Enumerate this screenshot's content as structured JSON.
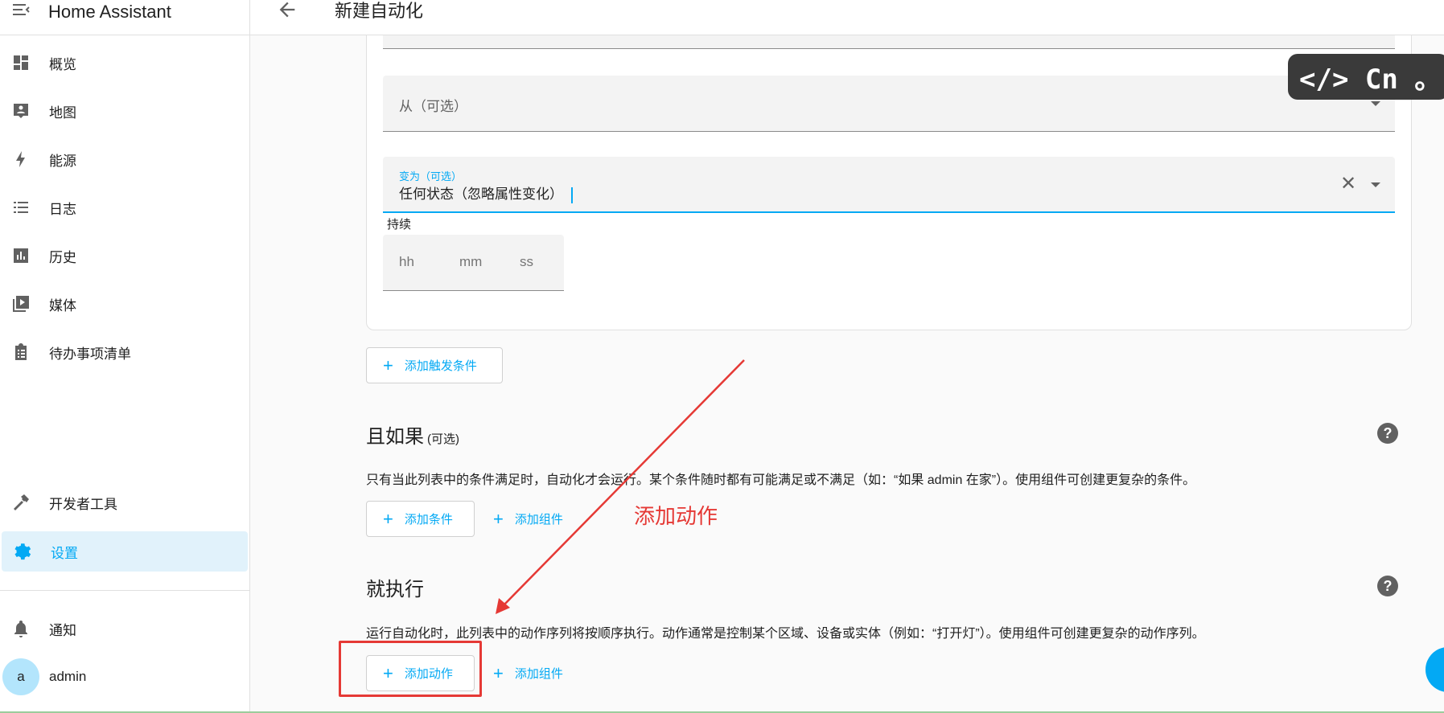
{
  "app": {
    "title": "Home Assistant"
  },
  "header": {
    "title": "新建自动化"
  },
  "sidebar": {
    "items": [
      {
        "label": "概览",
        "icon": "dashboard-icon"
      },
      {
        "label": "地图",
        "icon": "map-account-icon"
      },
      {
        "label": "能源",
        "icon": "lightning-bolt-icon"
      },
      {
        "label": "日志",
        "icon": "list-icon"
      },
      {
        "label": "历史",
        "icon": "chart-box-icon"
      },
      {
        "label": "媒体",
        "icon": "play-box-multiple-icon"
      },
      {
        "label": "待办事项清单",
        "icon": "clipboard-list-icon"
      }
    ],
    "developer_tools": "开发者工具",
    "settings": "设置",
    "notifications": "通知",
    "user": {
      "initial": "a",
      "name": "admin"
    },
    "accent_color": "#03a9f4"
  },
  "trigger": {
    "from_placeholder": "从（可选）",
    "to_label": "变为（可选）",
    "to_value": "任何状态（忽略属性变化）",
    "duration_label": "持续",
    "duration_fields": [
      "hh",
      "mm",
      "ss"
    ],
    "add_trigger": "添加触发条件"
  },
  "conditions": {
    "title": "且如果",
    "optional": "(可选)",
    "description": "只有当此列表中的条件满足时，自动化才会运行。某个条件随时都有可能满足或不满足（如：“如果 admin 在家”）。使用组件可创建更复杂的条件。",
    "add_condition": "添加条件",
    "add_building_block": "添加组件"
  },
  "actions": {
    "title": "就执行",
    "description": "运行自动化时，此列表中的动作序列将按顺序执行。动作通常是控制某个区域、设备或实体（例如：“打开灯”）。使用组件可创建更复杂的动作序列。",
    "add_action": "添加动作",
    "add_building_block": "添加组件"
  },
  "annotation": {
    "text": "添加动作",
    "color": "#e53935"
  },
  "overlay": {
    "text": "</> Cn 。"
  }
}
